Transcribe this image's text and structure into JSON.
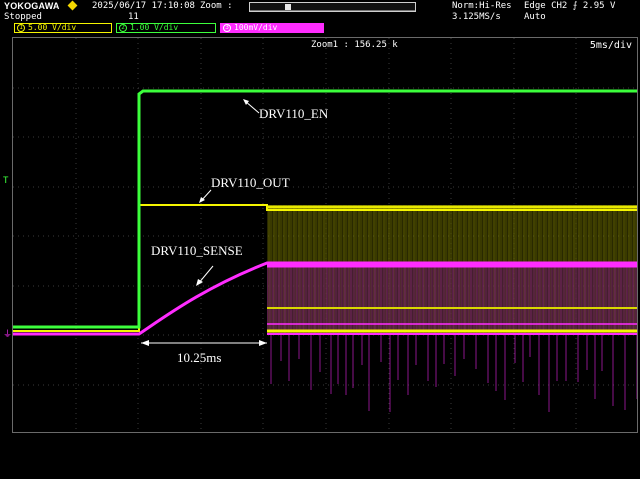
{
  "header": {
    "brand": "YOKOGAWA",
    "status": "Stopped",
    "datetime": "2025/06/17 17:10:08",
    "count": "11",
    "zoom_label": "Zoom :",
    "acq_mode": "Norm:Hi-Res",
    "sample_rate": "3.125MS/s",
    "trigger": "Edge CH2 ⨍ 2.95 V",
    "trigger_mode": "Auto"
  },
  "channels": [
    {
      "num": "1",
      "scale": "5.00 V/div",
      "color": "#f5f500"
    },
    {
      "num": "2",
      "scale": "1.00 V/div",
      "color": "#3cff3c"
    },
    {
      "num": "3",
      "scale": "100mV/div",
      "color": "#ff2cff"
    }
  ],
  "screen": {
    "zoom_info": "Zoom1 : 156.25 k",
    "timebase": "5ms/div",
    "labels": {
      "en": "DRV110_EN",
      "out": "DRV110_OUT",
      "sense": "DRV110_SENSE",
      "measure": "10.25ms"
    },
    "trigger_marker": "T",
    "ground_marker": "⏚"
  },
  "colors": {
    "ch1": "#f5f500",
    "ch2": "#3cff3c",
    "ch3": "#ff2cff",
    "grid": "#3a3a3a"
  }
}
